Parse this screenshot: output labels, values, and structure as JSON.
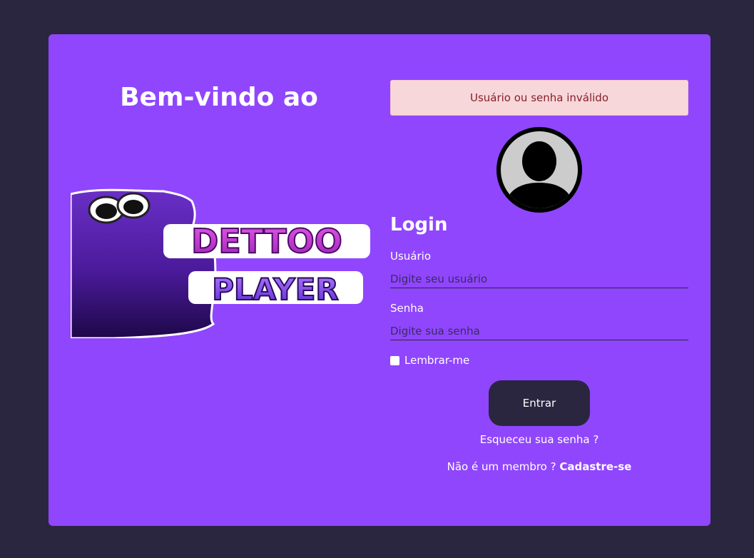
{
  "welcome": {
    "title": "Bem-vindo ao"
  },
  "logo": {
    "line1": "DETTOO",
    "line2": "PLAYER"
  },
  "alert": {
    "message": "Usuário ou senha inválido"
  },
  "login": {
    "title": "Login",
    "username_label": "Usuário",
    "username_placeholder": "Digite seu usuário",
    "password_label": "Senha",
    "password_placeholder": "Digite sua senha",
    "remember_label": "Lembrar-me",
    "submit_label": "Entrar",
    "forgot_label": "Esqueceu sua senha ?",
    "not_member_label": "Não é um membro ? ",
    "signup_label": "Cadastre-se"
  },
  "colors": {
    "background": "#2a2640",
    "card": "#9046fd",
    "alert_bg": "#f8d7da",
    "alert_text": "#842029",
    "button": "#2a2640"
  },
  "icons": {
    "avatar": "user-avatar-icon"
  }
}
